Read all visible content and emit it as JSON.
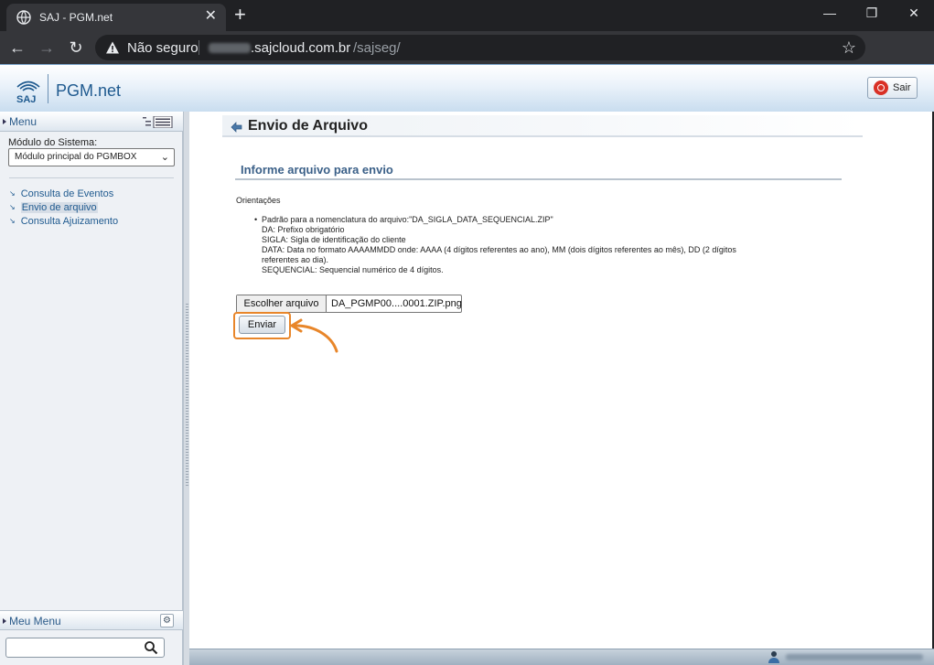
{
  "browser": {
    "tab_title": "SAJ - PGM.net",
    "tab_close": "✕",
    "new_tab": "+",
    "security_label": "Não seguro",
    "url_host": ".sajcloud.com.br",
    "url_path": "/sajseg/",
    "window_minimize": "—",
    "window_restore": "❐",
    "window_close": "✕"
  },
  "app": {
    "logo_mark": "SAJ",
    "logo_text": "PGM.net",
    "logout_label": "Sair",
    "accent_color": "#1f5a8f",
    "highlight_color": "#e8862a"
  },
  "sidebar": {
    "header": "Menu",
    "module_label": "Módulo do Sistema:",
    "module_selected": "Módulo principal do PGMBOX",
    "items": [
      {
        "label": "Consulta de Eventos"
      },
      {
        "label": "Envio de arquivo"
      },
      {
        "label": "Consulta Ajuizamento"
      }
    ],
    "my_menu": "Meu Menu"
  },
  "main": {
    "page_title": "Envio de Arquivo",
    "section_title": "Informe arquivo para envio",
    "orientations_label": "Orientações",
    "guide_lines": [
      "Padrão para a nomenclatura do arquivo:\"DA_SIGLA_DATA_SEQUENCIAL.ZIP\"",
      "DA: Prefixo obrigatório",
      "SIGLA: Sigla de identificação do cliente",
      "DATA: Data no formato AAAAMMDD onde: AAAA (4 dígitos referentes ao ano), MM (dois dígitos referentes ao mês), DD (2 dígitos",
      "referentes ao dia).",
      "SEQUENCIAL: Sequencial numérico de 4 dígitos."
    ],
    "choose_file_label": "Escolher arquivo",
    "file_name": "DA_PGMP00....0001.ZIP.png",
    "submit_label": "Enviar"
  }
}
